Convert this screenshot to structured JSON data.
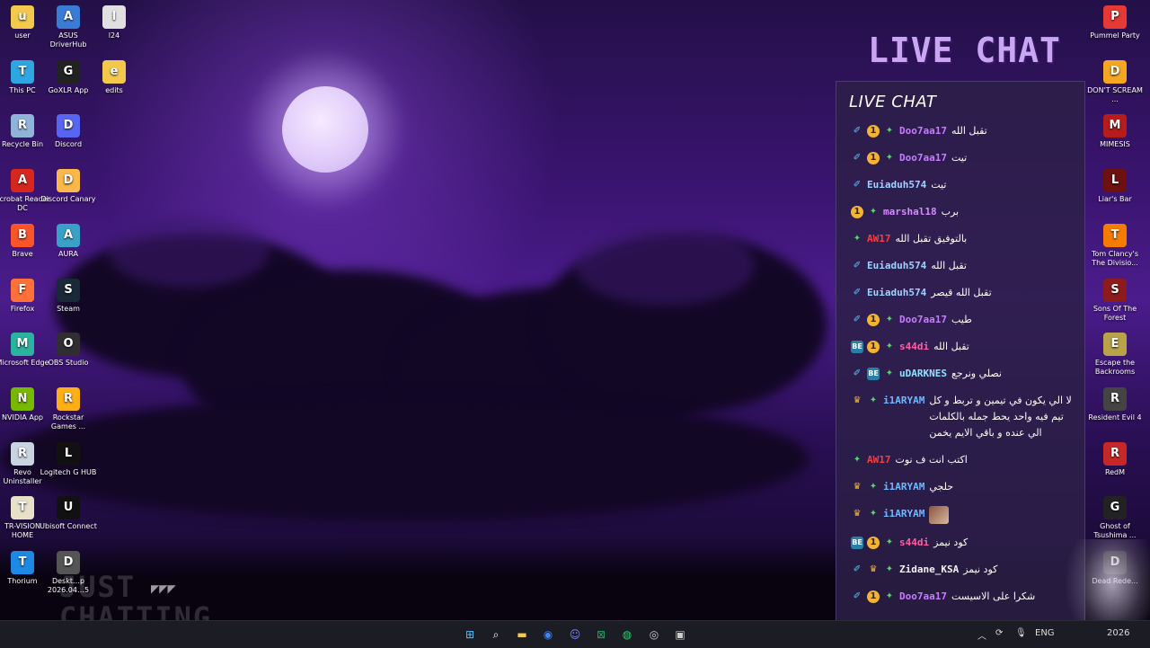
{
  "desktop_left": [
    {
      "label": "user",
      "icon": "folder-icon",
      "color": "#f2c94c",
      "col": 0,
      "row": 0
    },
    {
      "label": "ASUS DriverHub",
      "icon": "asus-gear-icon",
      "color": "#3a7bd5",
      "col": 1,
      "row": 0
    },
    {
      "label": "l24",
      "icon": "document-icon",
      "color": "#e0e0e0",
      "col": 2,
      "row": 0
    },
    {
      "label": "This PC",
      "icon": "monitor-icon",
      "color": "#2fa6e0",
      "col": 0,
      "row": 1
    },
    {
      "label": "GoXLR App",
      "icon": "goxlr-icon",
      "color": "#222222",
      "col": 1,
      "row": 1
    },
    {
      "label": "edits",
      "icon": "folder-icon",
      "color": "#f2c94c",
      "col": 2,
      "row": 1
    },
    {
      "label": "Recycle Bin",
      "icon": "recycle-bin-icon",
      "color": "#8fb3d9",
      "col": 0,
      "row": 2
    },
    {
      "label": "Discord",
      "icon": "discord-icon",
      "color": "#5865f2",
      "col": 1,
      "row": 2
    },
    {
      "label": "Acrobat Reader DC",
      "icon": "acrobat-icon",
      "color": "#d7261e",
      "col": 0,
      "row": 3
    },
    {
      "label": "Discord Canary",
      "icon": "discord-canary-icon",
      "color": "#fbb848",
      "col": 1,
      "row": 3
    },
    {
      "label": "Brave",
      "icon": "brave-icon",
      "color": "#fb542b",
      "col": 0,
      "row": 4
    },
    {
      "label": "AURA",
      "icon": "aura-icon",
      "color": "#3aa0c8",
      "col": 1,
      "row": 4
    },
    {
      "label": "Firefox",
      "icon": "firefox-icon",
      "color": "#ff7139",
      "col": 0,
      "row": 5
    },
    {
      "label": "Steam",
      "icon": "steam-icon",
      "color": "#1b2838",
      "col": 1,
      "row": 5
    },
    {
      "label": "Microsoft Edge",
      "icon": "edge-icon",
      "color": "#2bb3a0",
      "col": 0,
      "row": 6
    },
    {
      "label": "OBS Studio",
      "icon": "obs-icon",
      "color": "#302e31",
      "col": 1,
      "row": 6
    },
    {
      "label": "NVIDIA App",
      "icon": "nvidia-icon",
      "color": "#76b900",
      "col": 0,
      "row": 7
    },
    {
      "label": "Rockstar Games ...",
      "icon": "rockstar-icon",
      "color": "#fcaf17",
      "col": 1,
      "row": 7
    },
    {
      "label": "Revo Uninstaller",
      "icon": "revo-icon",
      "color": "#c8d4e0",
      "col": 0,
      "row": 8
    },
    {
      "label": "Logitech G HUB",
      "icon": "logitech-icon",
      "color": "#111111",
      "col": 1,
      "row": 8
    },
    {
      "label": "TR-VISION HOME",
      "icon": "trvision-icon",
      "color": "#e8e0c8",
      "col": 0,
      "row": 9
    },
    {
      "label": "Ubisoft Connect",
      "icon": "ubisoft-icon",
      "color": "#111111",
      "col": 1,
      "row": 9
    },
    {
      "label": "Thorium",
      "icon": "thorium-icon",
      "color": "#1e88e5",
      "col": 0,
      "row": 10
    },
    {
      "label": "Deskt…p 2026.04…5",
      "icon": "screenshot-file-icon",
      "color": "#555555",
      "col": 1,
      "row": 10
    }
  ],
  "desktop_right": [
    {
      "label": "Pummel Party",
      "icon": "pummel-party-icon",
      "color": "#e53935",
      "row": 0
    },
    {
      "label": "DON'T SCREAM ...",
      "icon": "dont-scream-icon",
      "color": "#f5a623",
      "row": 1
    },
    {
      "label": "MIMESIS",
      "icon": "mimesis-icon",
      "color": "#b71c1c",
      "row": 2
    },
    {
      "label": "Liar's Bar",
      "icon": "liars-bar-icon",
      "color": "#6d1010",
      "row": 3
    },
    {
      "label": "Tom Clancy's The Divisio...",
      "icon": "division-icon",
      "color": "#f57c00",
      "row": 4
    },
    {
      "label": "Sons Of The Forest",
      "icon": "sons-forest-icon",
      "color": "#8e1b1b",
      "row": 5
    },
    {
      "label": "Escape the Backrooms",
      "icon": "backrooms-icon",
      "color": "#b8a34a",
      "row": 6
    },
    {
      "label": "Resident Evil 4",
      "icon": "re4-icon",
      "color": "#444444",
      "row": 7
    },
    {
      "label": "RedM",
      "icon": "redm-icon",
      "color": "#c62828",
      "row": 8
    },
    {
      "label": "Ghost of Tsushima ...",
      "icon": "ghost-tsushima-icon",
      "color": "#222222",
      "row": 9
    },
    {
      "label": "Dead Rede...",
      "icon": "dead-redemption-icon",
      "color": "#333333",
      "row": 10
    }
  ],
  "overlay": {
    "big_title": "LIVE CHAT",
    "chat_header": "LIVE CHAT"
  },
  "chat": [
    {
      "badges": [
        "sword",
        "coin",
        "gem"
      ],
      "user": "Doo7aa17",
      "color": "#c77dff",
      "text": "تقبل الله"
    },
    {
      "badges": [
        "sword",
        "coin",
        "gem"
      ],
      "user": "Doo7aa17",
      "color": "#c77dff",
      "text": "تيت"
    },
    {
      "badges": [
        "sword"
      ],
      "user": "Euiaduh574",
      "color": "#9fd3ff",
      "text": "تيت"
    },
    {
      "badges": [
        "coin",
        "gem"
      ],
      "user": "marshal18",
      "color": "#d68cff",
      "text": "برب"
    },
    {
      "badges": [
        "gem"
      ],
      "user": "AW17",
      "color": "#ff3b3b",
      "text": "بالتوفيق تقبل الله"
    },
    {
      "badges": [
        "sword"
      ],
      "user": "Euiaduh574",
      "color": "#9fd3ff",
      "text": "تقبل الله"
    },
    {
      "badges": [
        "sword"
      ],
      "user": "Euiaduh574",
      "color": "#9fd3ff",
      "text": "تقبل الله قيصر"
    },
    {
      "badges": [
        "sword",
        "coin",
        "gem"
      ],
      "user": "Doo7aa17",
      "color": "#c77dff",
      "text": "طيب"
    },
    {
      "badges": [
        "bot",
        "coin",
        "gem"
      ],
      "user": "s44di",
      "color": "#ff5fa2",
      "text": "تقبل الله"
    },
    {
      "badges": [
        "sword",
        "bot",
        "gem"
      ],
      "user": "uDARKNES",
      "color": "#8fe3ff",
      "text": "نصلي ونرجع"
    },
    {
      "badges": [
        "crown",
        "gem"
      ],
      "user": "i1ARYAM",
      "color": "#6fb7ff",
      "text": "لا الي يكون في تيمين و تربط و كل تيم فيه واحد يحط جمله بالكلمات الي عنده و باقي الايم يخمن"
    },
    {
      "badges": [
        "gem"
      ],
      "user": "AW17",
      "color": "#ff3b3b",
      "text": "اكتب انت ف نوت"
    },
    {
      "badges": [
        "crown",
        "gem"
      ],
      "user": "i1ARYAM",
      "color": "#6fb7ff",
      "text": "حلجي"
    },
    {
      "badges": [
        "crown",
        "gem"
      ],
      "user": "i1ARYAM",
      "color": "#6fb7ff",
      "text": "",
      "emote": true
    },
    {
      "badges": [
        "bot",
        "coin",
        "gem"
      ],
      "user": "s44di",
      "color": "#ff5fa2",
      "text": "كود نيمز"
    },
    {
      "badges": [
        "sword",
        "crown",
        "gem"
      ],
      "user": "Zidane_KSA",
      "color": "#f2f2f2",
      "text": "كود نيمز"
    },
    {
      "badges": [
        "sword",
        "coin",
        "gem"
      ],
      "user": "Doo7aa17",
      "color": "#c77dff",
      "text": "شكرا على الاسيست"
    }
  ],
  "watermark": [
    "JUST",
    "CHATTING"
  ],
  "taskbar": {
    "lang": "ENG",
    "clock_date": "2026",
    "icons": [
      "windows-start-icon",
      "search-icon",
      "file-explorer-icon",
      "chrome-icon",
      "discord-icon",
      "excel-icon",
      "spotify-icon",
      "obs-icon",
      "terminal-icon"
    ]
  }
}
